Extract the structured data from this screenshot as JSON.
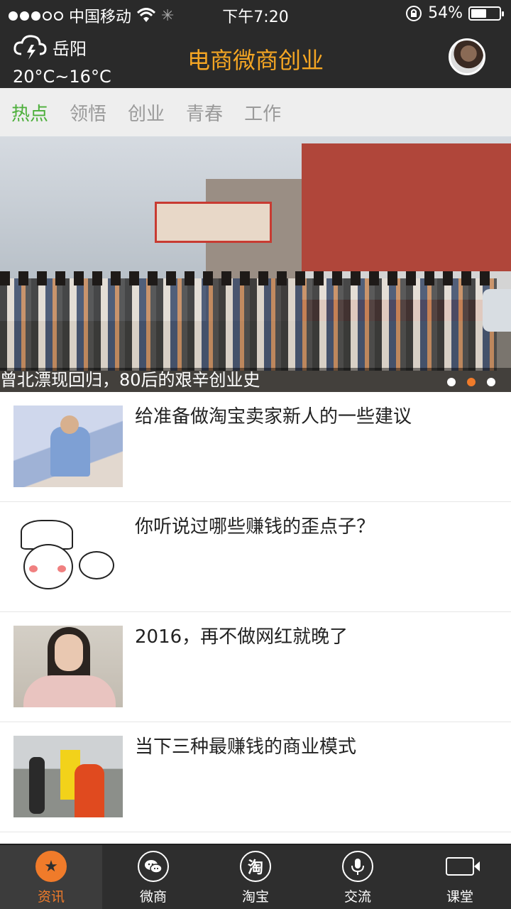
{
  "status_bar": {
    "carrier": "中国移动",
    "time": "下午7:20",
    "battery_text": "54%",
    "battery_level": 0.54
  },
  "header": {
    "city": "岳阳",
    "temperature": "20°C~16°C",
    "title": "电商微商创业",
    "title_color": "#f5a623",
    "weather_icon": "thunderstorm-cloud-icon"
  },
  "tabs": [
    {
      "label": "热点",
      "active": true
    },
    {
      "label": "领悟",
      "active": false
    },
    {
      "label": "创业",
      "active": false
    },
    {
      "label": "青春",
      "active": false
    },
    {
      "label": "工作",
      "active": false
    }
  ],
  "banner": {
    "caption": "曾北漂现回归，80后的艰辛创业史",
    "page_count": 3,
    "active_page": 2
  },
  "articles": [
    {
      "title": "给准备做淘宝卖家新人的一些建议"
    },
    {
      "title": "你听说过哪些赚钱的歪点子？"
    },
    {
      "title": "2016，再不做网红就晚了"
    },
    {
      "title": "当下三种最赚钱的商业模式"
    }
  ],
  "bottom_nav": [
    {
      "label": "资讯",
      "icon": "star-icon",
      "active": true
    },
    {
      "label": "微商",
      "icon": "wechat-icon",
      "active": false
    },
    {
      "label": "淘宝",
      "icon": "taobao-icon",
      "active": false
    },
    {
      "label": "交流",
      "icon": "microphone-icon",
      "active": false
    },
    {
      "label": "课堂",
      "icon": "video-camera-icon",
      "active": false
    }
  ],
  "colors": {
    "accent": "#f07b2a",
    "tab_active": "#4caf3a",
    "dark_bar": "#2a2a2a"
  }
}
